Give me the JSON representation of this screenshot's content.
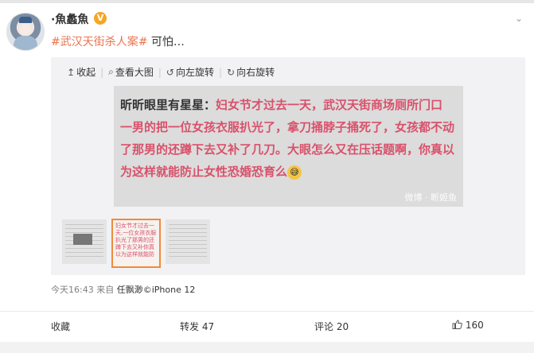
{
  "post": {
    "username": "·魚蠡魚",
    "badge": "V",
    "more_icon": "chevron-down-icon",
    "text_tag": "#武汉天街杀人案#",
    "text_rest": " 可怕…",
    "timestamp": "今天16:43",
    "source_prefix": "来自",
    "source": "任飘渺©iPhone 12"
  },
  "viewer": {
    "toolbar": [
      {
        "icon": "collapse-icon",
        "symbol": "↥",
        "label": "收起"
      },
      {
        "icon": "zoom-icon",
        "symbol": "⌕",
        "label": "查看大图"
      },
      {
        "icon": "rotate-left-icon",
        "symbol": "↺",
        "label": "向左旋转"
      },
      {
        "icon": "rotate-right-icon",
        "symbol": "↻",
        "label": "向右旋转"
      }
    ],
    "image_author": "昕昕眼里有星星：",
    "image_body": "妇女节才过去一天，武汉天街商场厕所门口一男的把一位女孩衣服扒光了，拿刀捅脖子捅死了，女孩都不动了那男的还蹲下去又补了几刀。大眼怎么又在压话题啊，你真以为这样就能防止女性恐婚恐育么",
    "emoji": "😅",
    "watermark": "微博 · 断姬鱼",
    "thumb_text": "妇女节才过去一天,一位女孩衣服扒光了那男的还蹲下去又补你真以为这样就能防"
  },
  "actions": {
    "collect": "收藏",
    "repost": "转发 47",
    "comment": "评论 20",
    "like_count": "160"
  },
  "colors": {
    "accent": "#eb7350",
    "highlight_text": "#d9516b",
    "thumb_border": "#ef8a3b"
  }
}
